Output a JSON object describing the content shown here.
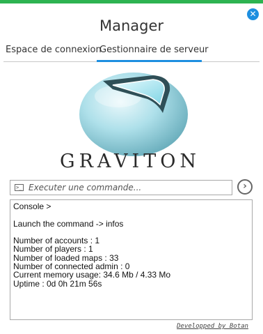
{
  "window": {
    "title": "Manager",
    "close_icon": "close-icon",
    "accent_color": "#1e8fe0",
    "top_bar_color": "#2db351"
  },
  "tabs": [
    {
      "label": "Espace de connexion",
      "active": false
    },
    {
      "label": "Gestionnaire de serveur",
      "active": true
    }
  ],
  "logo": {
    "text": "GRAVITON"
  },
  "command": {
    "placeholder": "Executer une commande...",
    "value": "",
    "terminal_icon": "terminal-icon",
    "submit_icon": "chevron-right-circle-icon"
  },
  "console": {
    "lines": [
      "Console >",
      "",
      "Launch the command -> infos",
      "",
      "Number of accounts : 1",
      "Number of players : 1",
      "Number of loaded maps : 33",
      "Number of connected admin : 0",
      "Current memory usage: 34.6 Mb / 4.33 Mo",
      "Uptime : 0d 0h 21m 56s"
    ]
  },
  "footer": {
    "text": "Developped by Botan"
  }
}
